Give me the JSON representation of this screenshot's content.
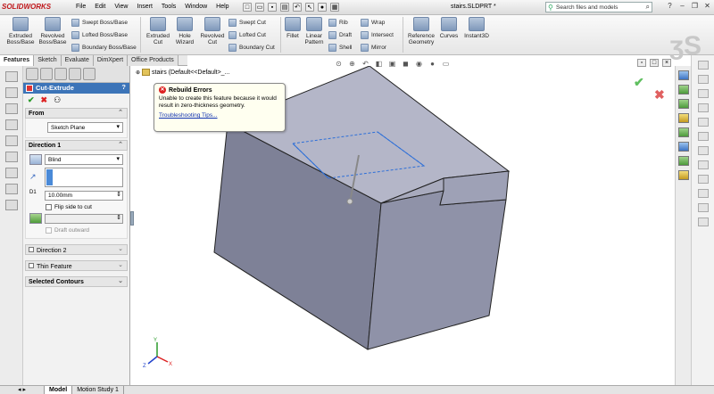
{
  "app": {
    "name": "SOLIDWORKS",
    "document_title": "stairs.SLDPRT *"
  },
  "menu": [
    "File",
    "Edit",
    "View",
    "Insert",
    "Tools",
    "Window",
    "Help"
  ],
  "search": {
    "placeholder": "Search files and models"
  },
  "ribbon": {
    "extruded_boss": "Extruded Boss/Base",
    "revolved_boss": "Revolved Boss/Base",
    "swept_boss": "Swept Boss/Base",
    "lofted_boss": "Lofted Boss/Base",
    "boundary_boss": "Boundary Boss/Base",
    "extruded_cut": "Extruded Cut",
    "hole_wizard": "Hole Wizard",
    "revolved_cut": "Revolved Cut",
    "swept_cut": "Swept Cut",
    "lofted_cut": "Lofted Cut",
    "boundary_cut": "Boundary Cut",
    "fillet": "Fillet",
    "linear_pattern": "Linear Pattern",
    "rib": "Rib",
    "draft": "Draft",
    "shell": "Shell",
    "wrap": "Wrap",
    "intersect": "Intersect",
    "mirror": "Mirror",
    "reference_geometry": "Reference Geometry",
    "curves": "Curves",
    "instant3d": "Instant3D"
  },
  "tabs": [
    "Features",
    "Sketch",
    "Evaluate",
    "DimXpert",
    "Office Products"
  ],
  "tree": {
    "root": "stairs  (Default<<Default>_..."
  },
  "property_manager": {
    "title": "Cut-Extrude",
    "from": {
      "label": "From",
      "value": "Sketch Plane"
    },
    "direction1": {
      "label": "Direction 1",
      "end_condition": "Blind",
      "depth": "10.00mm",
      "flip_label": "Flip side to cut",
      "draft_label": "Draft outward"
    },
    "direction2": {
      "label": "Direction 2"
    },
    "thin_feature": {
      "label": "Thin Feature"
    },
    "selected_contours": {
      "label": "Selected Contours"
    }
  },
  "error_tip": {
    "title": "Rebuild Errors",
    "message": "Unable to create this feature because it would result in zero-thickness geometry.",
    "link": "Troubleshooting Tips..."
  },
  "bottom_tabs": [
    "Model",
    "Motion Study 1"
  ],
  "colors": {
    "accent": "#3c74b8",
    "model_face": "#8f92a8",
    "error": "#dd2222",
    "ok": "#2a9a2a"
  }
}
